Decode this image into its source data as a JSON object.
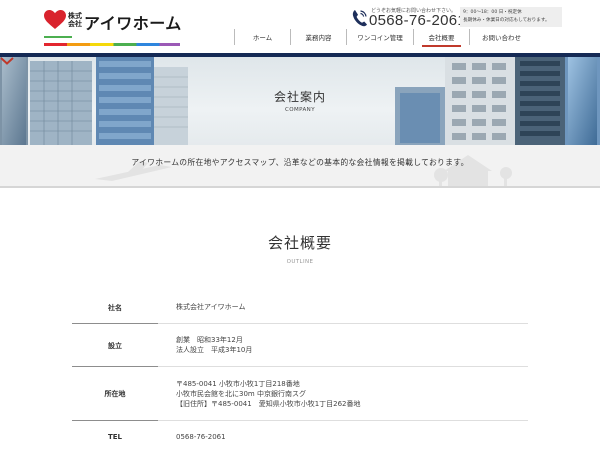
{
  "header": {
    "logo": {
      "corp_prefix": "株式会社",
      "name": "アイワホーム"
    },
    "contact": {
      "note": "どうぞお気軽にお問い合わせ下さい。",
      "phone": "0568-76-2061",
      "hours_line1": "9：00～18：00 日・祝定休",
      "hours_line2": "長期休み・休業日の対応もしております。"
    },
    "nav": [
      {
        "label": "ホーム",
        "active": false
      },
      {
        "label": "業務内容",
        "active": false
      },
      {
        "label": "ワンコイン管理",
        "active": false
      },
      {
        "label": "会社概要",
        "active": true
      },
      {
        "label": "お問い合わせ",
        "active": false
      }
    ]
  },
  "hero": {
    "title": "会社案内",
    "subtitle": "COMPANY"
  },
  "intro": {
    "text": "アイワホームの所在地やアクセスマップ、沿革などの基本的な会社情報を掲載しております。"
  },
  "section": {
    "title": "会社概要",
    "subtitle": "OUTLINE"
  },
  "outline": [
    {
      "label": "社名",
      "lines": [
        "株式会社アイワホーム"
      ]
    },
    {
      "label": "設立",
      "lines": [
        "創業　昭和33年12月",
        "法人設立　平成3年10月"
      ]
    },
    {
      "label": "所在地",
      "lines": [
        "〒485-0041 小牧市小牧1丁目218番地",
        "小牧市民会館を北に30m 中京銀行南スグ",
        "【旧住所】〒485-0041　愛知県小牧市小牧1丁目262番地"
      ]
    },
    {
      "label": "TEL",
      "lines": [
        "0568-76-2061"
      ]
    }
  ],
  "colors": {
    "accent_red": "#c0392b",
    "navy": "#152a55",
    "band_bg": "#f2f2f2"
  }
}
